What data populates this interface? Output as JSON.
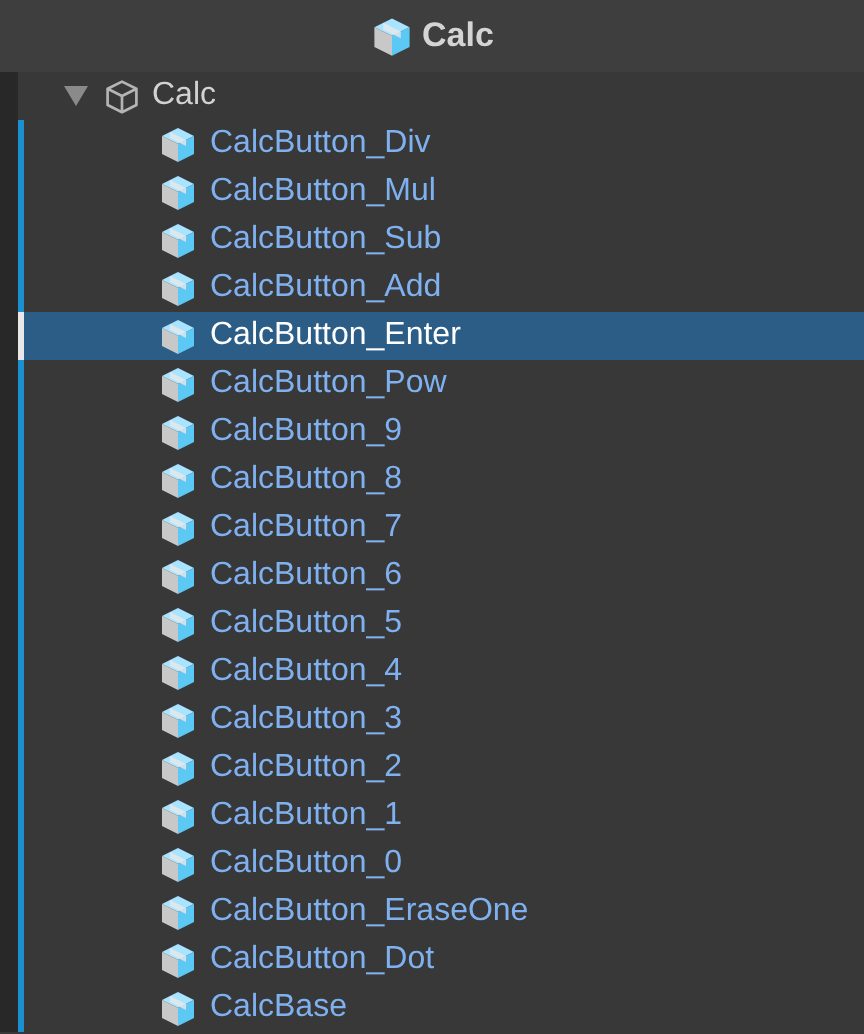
{
  "header": {
    "title": "Calc"
  },
  "tree": [
    {
      "name": "Calc",
      "kind": "object",
      "expanded": true,
      "selected": false,
      "children": [
        {
          "name": "CalcButton_Div",
          "kind": "prefab",
          "selected": false
        },
        {
          "name": "CalcButton_Mul",
          "kind": "prefab",
          "selected": false
        },
        {
          "name": "CalcButton_Sub",
          "kind": "prefab",
          "selected": false
        },
        {
          "name": "CalcButton_Add",
          "kind": "prefab",
          "selected": false
        },
        {
          "name": "CalcButton_Enter",
          "kind": "prefab",
          "selected": true
        },
        {
          "name": "CalcButton_Pow",
          "kind": "prefab",
          "selected": false
        },
        {
          "name": "CalcButton_9",
          "kind": "prefab",
          "selected": false
        },
        {
          "name": "CalcButton_8",
          "kind": "prefab",
          "selected": false
        },
        {
          "name": "CalcButton_7",
          "kind": "prefab",
          "selected": false
        },
        {
          "name": "CalcButton_6",
          "kind": "prefab",
          "selected": false
        },
        {
          "name": "CalcButton_5",
          "kind": "prefab",
          "selected": false
        },
        {
          "name": "CalcButton_4",
          "kind": "prefab",
          "selected": false
        },
        {
          "name": "CalcButton_3",
          "kind": "prefab",
          "selected": false
        },
        {
          "name": "CalcButton_2",
          "kind": "prefab",
          "selected": false
        },
        {
          "name": "CalcButton_1",
          "kind": "prefab",
          "selected": false
        },
        {
          "name": "CalcButton_0",
          "kind": "prefab",
          "selected": false
        },
        {
          "name": "CalcButton_EraseOne",
          "kind": "prefab",
          "selected": false
        },
        {
          "name": "CalcButton_Dot",
          "kind": "prefab",
          "selected": false
        },
        {
          "name": "CalcBase",
          "kind": "prefab",
          "selected": false
        }
      ]
    }
  ]
}
